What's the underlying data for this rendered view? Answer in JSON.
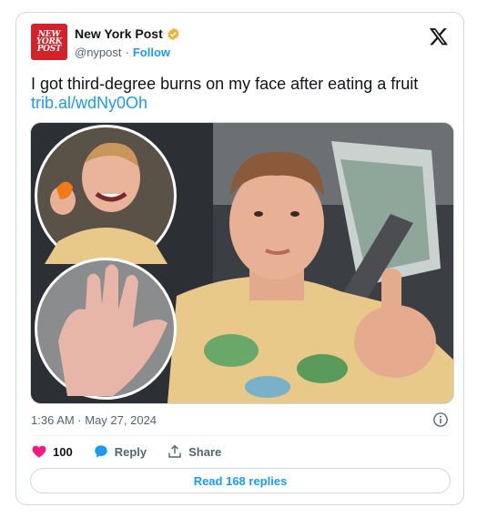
{
  "author": {
    "name": "New York Post",
    "handle": "@nypost",
    "separator": "·",
    "follow_label": "Follow",
    "avatar_text_line1": "NEW",
    "avatar_text_line2": "YORK",
    "avatar_text_line3": "POST",
    "verified_badge_color": "#e8b53e",
    "avatar_color": "#d2232a"
  },
  "tweet": {
    "text": "I got third-degree burns on my face after eating a fruit",
    "link": "trib.al/wdNy0Oh"
  },
  "media": {
    "description_icon": "photo-collage"
  },
  "meta": {
    "timestamp": "1:36 AM · May 27, 2024"
  },
  "actions": {
    "like_count": "100",
    "reply_label": "Reply",
    "share_label": "Share",
    "read_replies_label": "Read 168 replies"
  },
  "colors": {
    "accent": "#1d9bf0",
    "like": "#f91880",
    "muted": "#536471"
  }
}
